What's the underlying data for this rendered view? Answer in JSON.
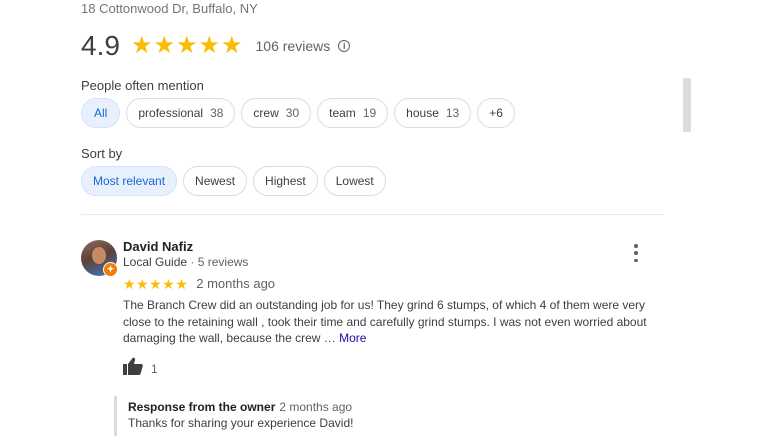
{
  "place": {
    "address": "18 Cottonwood Dr, Buffalo, NY",
    "rating": "4.9",
    "stars": "★★★★★",
    "reviews_count": "106 reviews",
    "info_icon": "info-icon"
  },
  "mentions": {
    "label": "People often mention",
    "chips": [
      {
        "label": "All",
        "count": "",
        "selected": true
      },
      {
        "label": "professional",
        "count": "38"
      },
      {
        "label": "crew",
        "count": "30"
      },
      {
        "label": "team",
        "count": "19"
      },
      {
        "label": "house",
        "count": "13"
      },
      {
        "label": "+6",
        "count": ""
      }
    ]
  },
  "sort": {
    "label": "Sort by",
    "options": [
      {
        "label": "Most relevant",
        "selected": true
      },
      {
        "label": "Newest"
      },
      {
        "label": "Highest"
      },
      {
        "label": "Lowest"
      }
    ]
  },
  "review": {
    "name": "David Nafiz",
    "guide": "Local Guide",
    "sep": " · ",
    "reviewer_count": "5 reviews",
    "stars": "★★★★★",
    "date": "2 months ago",
    "text": "The Branch Crew did an outstanding job for us! They grind 6 stumps, of which 4 of them were very close to the retaining wall , took their time and carefully grind stumps. I was not even worried about damaging the wall, because the crew … ",
    "more": "More",
    "likes": "1",
    "icons": {
      "more": "more-vert-icon",
      "like": "thumbs-up-icon",
      "badge": "local-guide-badge-icon"
    }
  },
  "owner_response": {
    "title": "Response from the owner",
    "date": "2 months ago",
    "text": "Thanks for sharing your experience David!"
  },
  "colors": {
    "star": "#fbbc04",
    "selected_chip_bg": "#e8f0fe",
    "selected_chip_text": "#1967d2",
    "link": "#1a0dab",
    "badge": "#f57c00"
  }
}
